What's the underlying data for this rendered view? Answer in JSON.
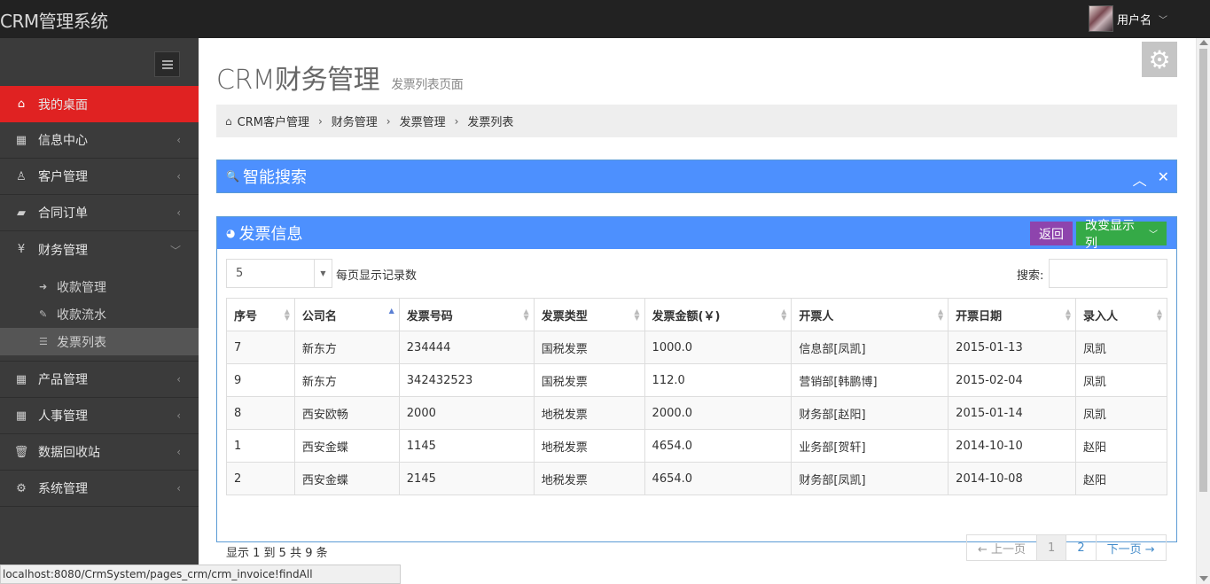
{
  "app": {
    "brand": "CRM管理系统",
    "user_name": "用户名"
  },
  "sidebar": {
    "items": [
      {
        "label": "我的桌面",
        "icon": "home-icon",
        "active": true
      },
      {
        "label": "信息中心",
        "icon": "calendar-icon"
      },
      {
        "label": "客户管理",
        "icon": "person-icon"
      },
      {
        "label": "合同订单",
        "icon": "book-icon"
      },
      {
        "label": "财务管理",
        "icon": "yen-icon",
        "expanded": true
      },
      {
        "label": "产品管理",
        "icon": "table-icon"
      },
      {
        "label": "人事管理",
        "icon": "table-icon"
      },
      {
        "label": "数据回收站",
        "icon": "trash-icon"
      },
      {
        "label": "系统管理",
        "icon": "gear-icon"
      }
    ],
    "finance_sub": [
      {
        "label": "收款管理",
        "icon": "sign-in-icon"
      },
      {
        "label": "收款流水",
        "icon": "pencil-icon"
      },
      {
        "label": "发票列表",
        "icon": "list-icon",
        "current": true
      }
    ]
  },
  "page": {
    "title": "CRM财务管理",
    "subtitle": "发票列表页面"
  },
  "breadcrumb": [
    "CRM客户管理",
    "财务管理",
    "发票管理",
    "发票列表"
  ],
  "search_panel": {
    "title": "智能搜索"
  },
  "invoice_panel": {
    "title": "发票信息",
    "back_label": "返回",
    "columns_label": "改变显示列",
    "page_length": "5",
    "page_length_label": "每页显示记录数",
    "search_label": "搜索:",
    "headers": [
      "序号",
      "公司名",
      "发票号码",
      "发票类型",
      "发票金额(￥)",
      "开票人",
      "开票日期",
      "录入人"
    ],
    "rows": [
      [
        "7",
        "新东方",
        "234444",
        "国税发票",
        "1000.0",
        "信息部[凤凯]",
        "2015-01-13",
        "凤凯"
      ],
      [
        "9",
        "新东方",
        "342432523",
        "国税发票",
        "112.0",
        "营销部[韩鹏博]",
        "2015-02-04",
        "凤凯"
      ],
      [
        "8",
        "西安欧畅",
        "2000",
        "地税发票",
        "2000.0",
        "财务部[赵阳]",
        "2015-01-14",
        "凤凯"
      ],
      [
        "1",
        "西安金蝶",
        "1145",
        "地税发票",
        "4654.0",
        "业务部[贺轩]",
        "2014-10-10",
        "赵阳"
      ],
      [
        "2",
        "西安金蝶",
        "2145",
        "地税发票",
        "4654.0",
        "财务部[凤凯]",
        "2014-10-08",
        "赵阳"
      ]
    ],
    "info": "显示 1 到 5 共 9 条",
    "pager": {
      "prev": "← 上一页",
      "page1": "1",
      "page2": "2",
      "next": "下一页 →"
    }
  },
  "status_url": "localhost:8080/CrmSystem/pages_crm/crm_invoice!findAll"
}
